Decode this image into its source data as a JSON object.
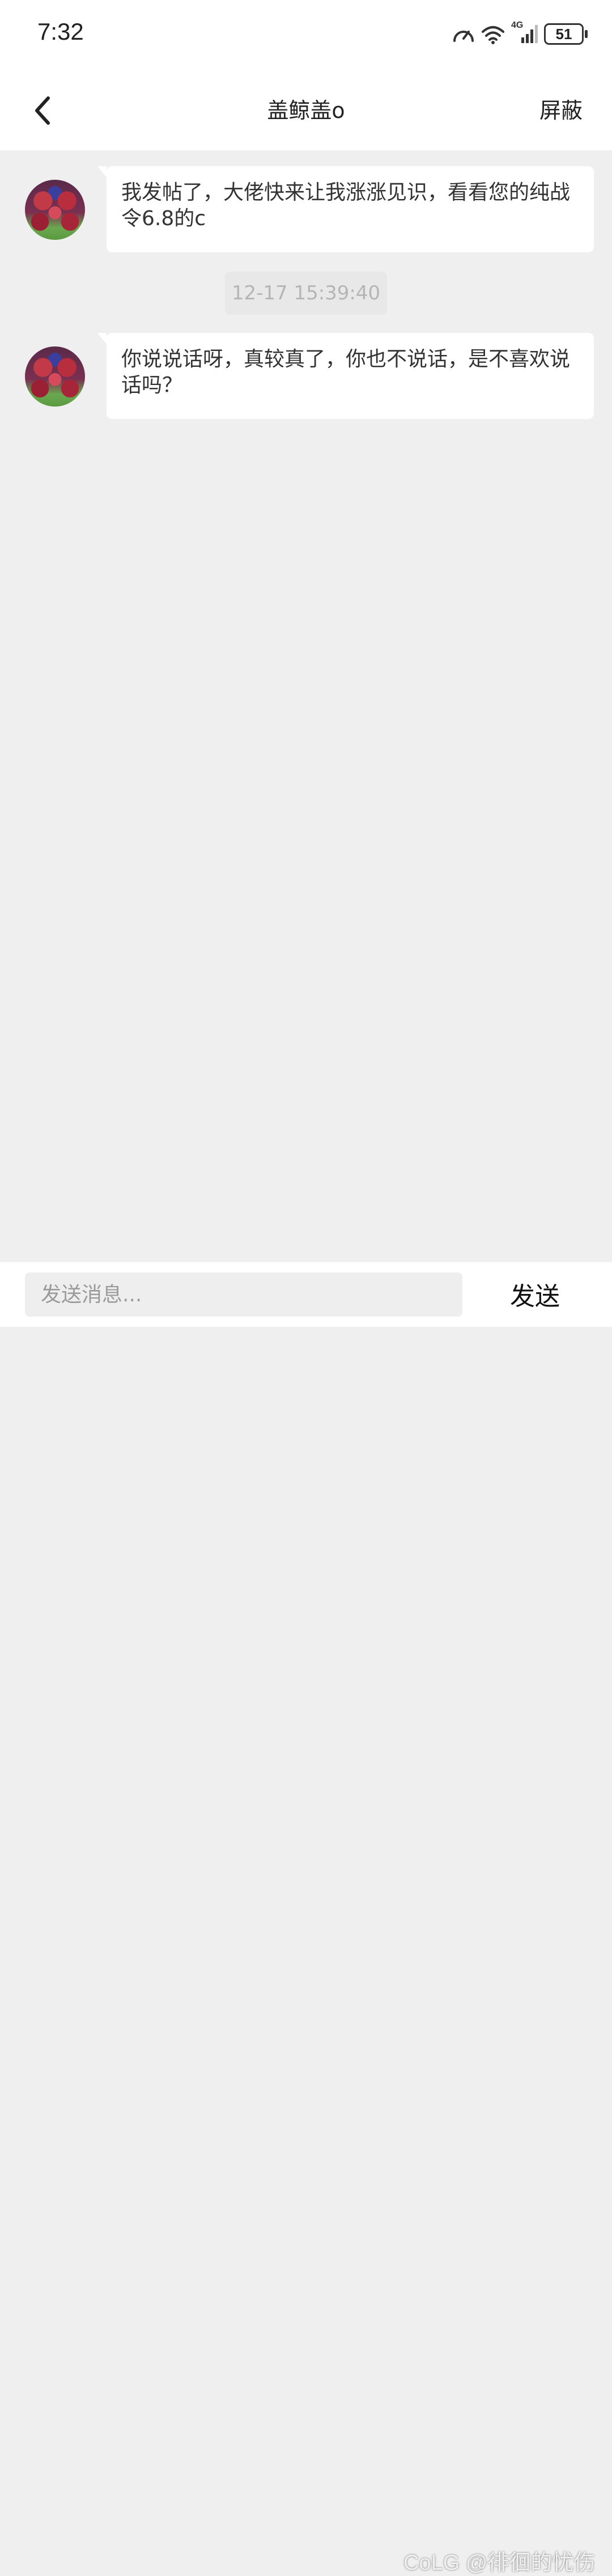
{
  "status_bar": {
    "time": "7:32",
    "battery": "51",
    "network": "4G",
    "icons": [
      "speedometer-icon",
      "wifi-icon",
      "signal-icon",
      "battery-icon"
    ]
  },
  "header": {
    "title": "盖鲸盖o",
    "block_label": "屏蔽",
    "back_icon": "chevron-left-icon"
  },
  "messages": [
    {
      "text": "我发帖了，大佬快来让我涨涨见识，看看您的纯战令6.8的c"
    },
    {
      "text": "你说说话呀，真较真了，你也不说话，是不喜欢说话吗？"
    }
  ],
  "timestamp": "12-17 15:39:40",
  "input": {
    "placeholder": "发送消息...",
    "value": "",
    "send_label": "发送"
  },
  "watermark": "CoLG @徘徊的忧伤",
  "colors": {
    "background": "#efefef",
    "bubble": "#ffffff",
    "timestamp_text": "#b5b5b5"
  }
}
